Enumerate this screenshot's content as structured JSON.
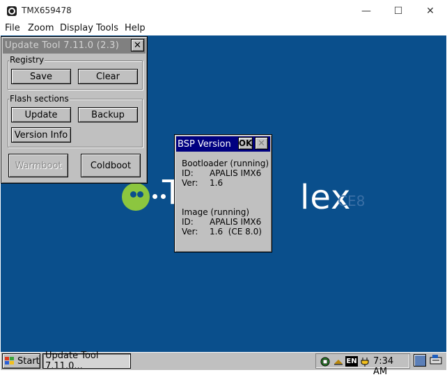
{
  "host": {
    "title": "TMX659478",
    "menu": [
      "File",
      "Zoom",
      "Display",
      "Tools",
      "Help"
    ],
    "minimize_glyph": "—",
    "maximize_glyph": "☐",
    "close_glyph": "✕"
  },
  "desktop": {
    "logo_text": "lex",
    "logo_prefix": "T",
    "logo_suffix": "CE8"
  },
  "update_tool": {
    "title": "Update Tool 7.11.0 (2.3)",
    "close": "✕",
    "registry": {
      "label": "Registry",
      "save": "Save",
      "clear": "Clear"
    },
    "flash": {
      "label": "Flash sections",
      "update": "Update",
      "backup": "Backup",
      "version_info": "Version Info"
    },
    "warmboot": "Warmboot",
    "coldboot": "Coldboot"
  },
  "bsp_dialog": {
    "title": "BSP Version",
    "ok": "OK",
    "close": "✕",
    "bootloader": {
      "heading": "Bootloader (running)",
      "id_label": "ID:",
      "id_value": "APALIS IMX6",
      "ver_label": "Ver:",
      "ver_value": "1.6"
    },
    "image": {
      "heading": "Image (running)",
      "id_label": "ID:",
      "id_value": "APALIS IMX6",
      "ver_label": "Ver:",
      "ver_value": "1.6  (CE 8.0)"
    }
  },
  "taskbar": {
    "start": "Start",
    "task_item": "Update Tool 7.11.0...",
    "lang": "EN",
    "time": "7:34 AM"
  },
  "colors": {
    "desktop": "#0a4f8c",
    "logo_green": "#8cc63f",
    "dialog_title": "#000080",
    "inactive_title": "#808080"
  }
}
